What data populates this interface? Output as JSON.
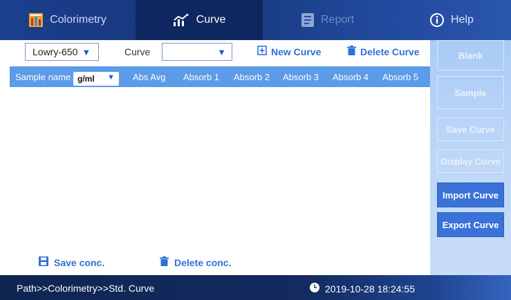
{
  "tabs": [
    {
      "label": "Colorimetry",
      "icon": "colorimetry-icon",
      "state": "normal"
    },
    {
      "label": "Curve",
      "icon": "chart-icon",
      "state": "active"
    },
    {
      "label": "Report",
      "icon": "report-icon",
      "state": "disabled"
    },
    {
      "label": "Help",
      "icon": "info-icon",
      "state": "normal"
    }
  ],
  "toolbar": {
    "method_select": "Lowry-650",
    "curve_label": "Curve",
    "curve_select": "",
    "new_curve": "New Curve",
    "delete_curve": "Delete Curve"
  },
  "table": {
    "sample_name": "Sample name",
    "unit": "g/ml",
    "columns": [
      "Abs Avg",
      "Absorb 1",
      "Absorb 2",
      "Absorb 3",
      "Absorb 4",
      "Absorb 5"
    ],
    "rows": []
  },
  "right_panel": {
    "blank": "Blank",
    "sample": "Sample",
    "save_curve": "Save Curve",
    "display_curve": "Display Curve",
    "import_curve": "Import Curve",
    "export_curve": "Export Curve"
  },
  "bottom": {
    "save_conc": "Save conc.",
    "delete_conc": "Delete conc."
  },
  "status": {
    "path": "Path>>Colorimetry>>Std. Curve",
    "datetime": "2019-10-28 18:24:55"
  },
  "colors": {
    "header_blue": "#5b9be8",
    "accent_blue": "#2f6fd8",
    "active_button": "#3b72d8"
  }
}
